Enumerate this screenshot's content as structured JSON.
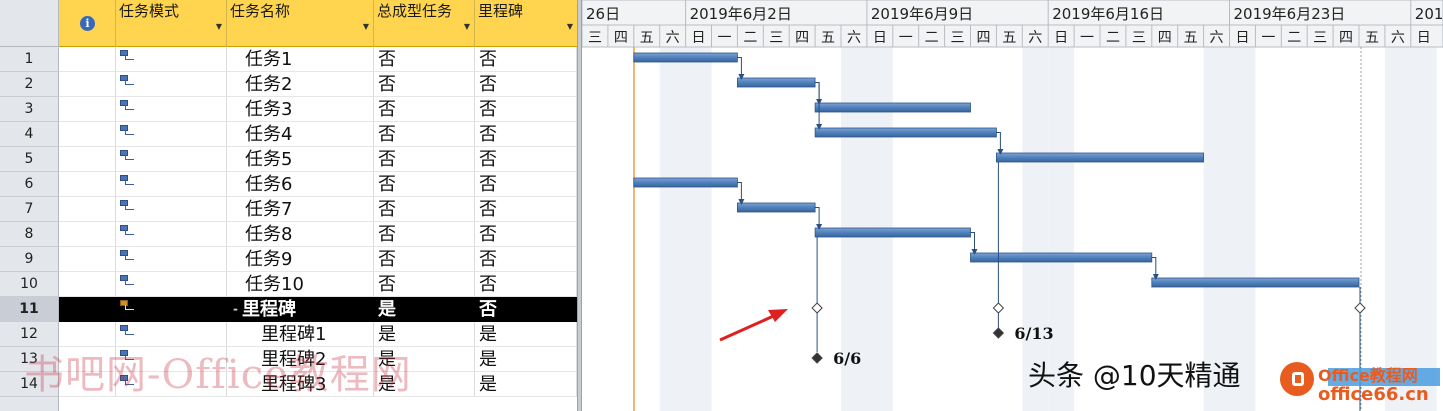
{
  "grid": {
    "headers": {
      "info": "i",
      "mode": "任务模式",
      "name": "任务名称",
      "summary": "总成型任务",
      "milestone": "里程碑"
    },
    "rows": [
      {
        "num": "1",
        "name": "任务1",
        "summary": "否",
        "milestone": "否"
      },
      {
        "num": "2",
        "name": "任务2",
        "summary": "否",
        "milestone": "否"
      },
      {
        "num": "3",
        "name": "任务3",
        "summary": "否",
        "milestone": "否"
      },
      {
        "num": "4",
        "name": "任务4",
        "summary": "否",
        "milestone": "否"
      },
      {
        "num": "5",
        "name": "任务5",
        "summary": "否",
        "milestone": "否"
      },
      {
        "num": "6",
        "name": "任务6",
        "summary": "否",
        "milestone": "否"
      },
      {
        "num": "7",
        "name": "任务7",
        "summary": "否",
        "milestone": "否"
      },
      {
        "num": "8",
        "name": "任务8",
        "summary": "否",
        "milestone": "否"
      },
      {
        "num": "9",
        "name": "任务9",
        "summary": "否",
        "milestone": "否"
      },
      {
        "num": "10",
        "name": "任务10",
        "summary": "否",
        "milestone": "否"
      },
      {
        "num": "11",
        "name": "里程碑",
        "summary": "是",
        "milestone": "否",
        "selected": true,
        "collapse": "-"
      },
      {
        "num": "12",
        "name": "里程碑1",
        "summary": "是",
        "milestone": "是"
      },
      {
        "num": "13",
        "name": "里程碑2",
        "summary": "是",
        "milestone": "是"
      },
      {
        "num": "14",
        "name": "里程碑3",
        "summary": "是",
        "milestone": "是"
      }
    ]
  },
  "timescale": {
    "weeks": [
      "26日",
      "2019年6月2日",
      "2019年6月9日",
      "2019年6月16日",
      "2019年6月23日",
      "201"
    ],
    "days": [
      "三",
      "四",
      "五",
      "六",
      "日",
      "一",
      "二",
      "三",
      "四",
      "五",
      "六",
      "日",
      "一",
      "二",
      "三",
      "四",
      "五",
      "六",
      "日",
      "一",
      "二",
      "三",
      "四",
      "五",
      "六",
      "日",
      "一",
      "二",
      "三",
      "四",
      "五",
      "六",
      "日"
    ]
  },
  "gantt": {
    "milestone_labels": [
      "6/13",
      "6/6"
    ]
  },
  "colors": {
    "header_gold": "#ffd54f",
    "bar_blue": "#4f81bd",
    "link_blue": "#2b4f80",
    "weekend_shade": "#eef2f7",
    "arrow_red": "#e02020"
  },
  "overlay": {
    "watermark": "书吧网-Office教程网",
    "bottom_text": "头条 @10天精通",
    "logo_text": "Office教程网",
    "logo_url": "office66.cn"
  }
}
